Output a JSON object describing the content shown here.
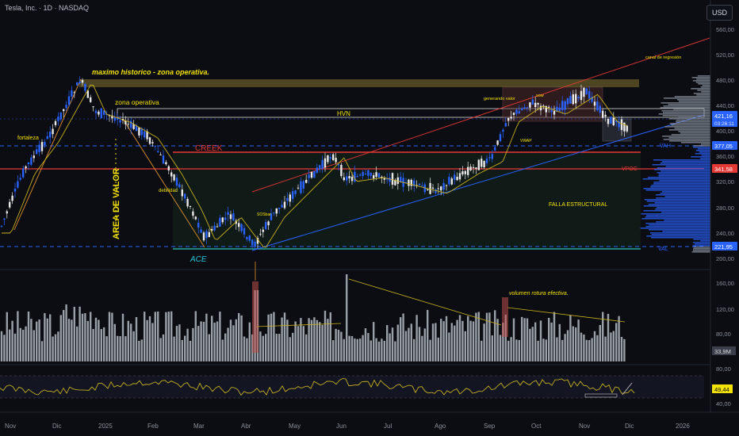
{
  "header": {
    "title": "Tesla, Inc. · 1D · NASDAQ",
    "currency": "USD"
  },
  "price_axis": {
    "ticks": [
      "560,00",
      "520,00",
      "480,00",
      "440,00",
      "400,00",
      "360,00",
      "320,00",
      "280,00",
      "240,00",
      "200,00"
    ],
    "badges": [
      {
        "label": "421,16",
        "sub": "03:26:11",
        "color": "#2962ff"
      },
      {
        "label": "377,05",
        "color": "#2962ff"
      },
      {
        "label": "341,58",
        "color": "#e53935"
      },
      {
        "label": "221,95",
        "color": "#2962ff"
      }
    ]
  },
  "volume_axis": {
    "ticks": [
      "160,00",
      "120,00",
      "80,00"
    ],
    "badge": "33,9M"
  },
  "rsi_axis": {
    "ticks": [
      "80,00",
      "40,00"
    ],
    "badge": "49,44",
    "badge_color": "#f2e205"
  },
  "time_axis": {
    "labels": [
      "Nov",
      "Dic",
      "2025",
      "Feb",
      "Mar",
      "Abr",
      "May",
      "Jun",
      "Jul",
      "Ago",
      "Sep",
      "Oct",
      "Nov",
      "Dic",
      "2026"
    ]
  },
  "annotations": {
    "max_hist": "maximo historico - zona operativa.",
    "zona_op": "zona operativa",
    "fortaleza": "fortaleza",
    "area_valor": "AREA DE VALOR",
    "debilidad": "debilidad",
    "creek": "CREEK",
    "ace": "ACE",
    "hvn": "HVN",
    "vah": "VAH",
    "vpoc": "VPOC",
    "val": "VAL",
    "falla": "FALLA ESTRUCTURAL",
    "canal": "canal de regresión",
    "generando": "generando valor",
    "vwap": "VWAP",
    "sow": "sow",
    "sosbar": "SOSbar",
    "volumen": "volumen rotura efectiva."
  },
  "colors": {
    "accent": "#2962ff",
    "red": "#e53935",
    "gold": "#f2e205",
    "up": "#e8e8e8",
    "down": "#2962ff"
  }
}
